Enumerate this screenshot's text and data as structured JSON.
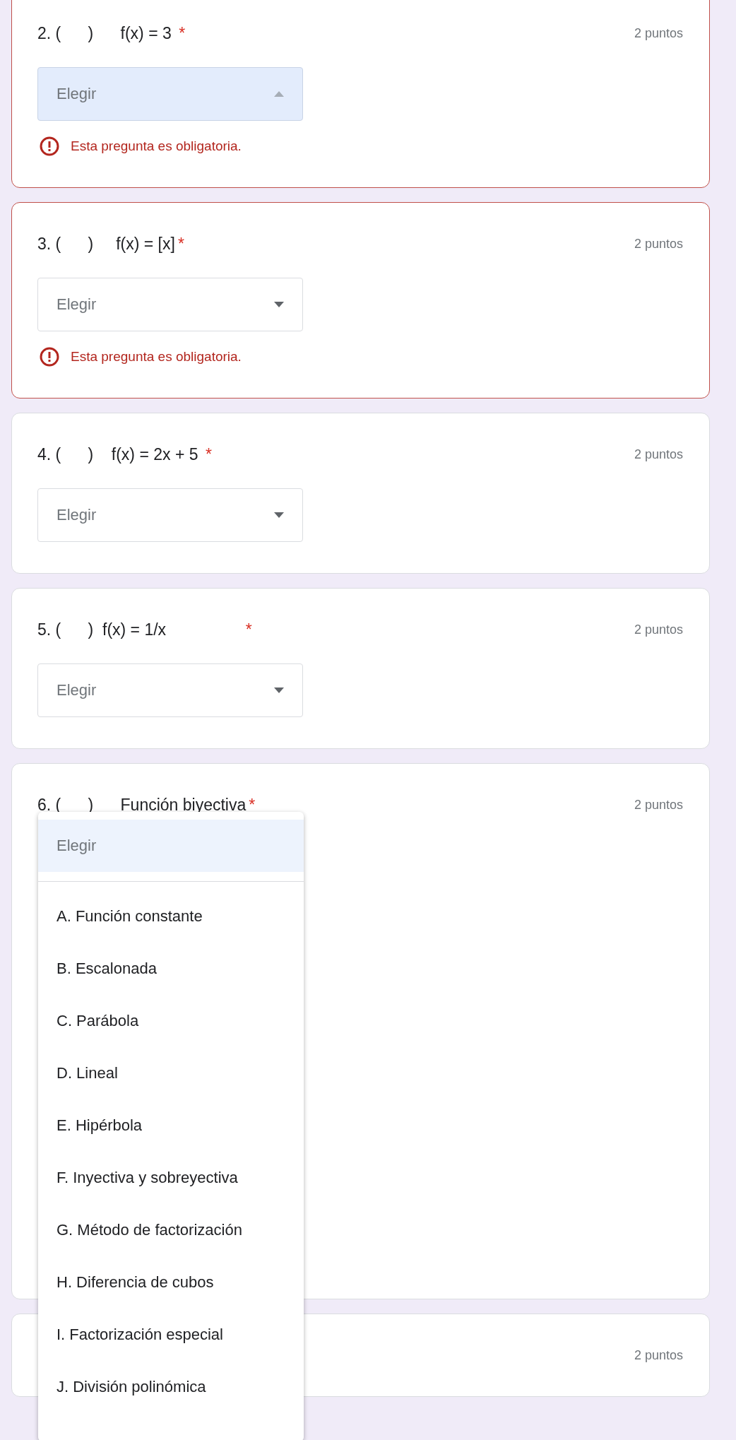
{
  "questions": [
    {
      "title": "2. (      )      f(x) = 3 ",
      "required": true,
      "required_mark": "*",
      "points": "2 puntos",
      "dropdown": {
        "placeholder": "Elegir",
        "focused": true
      },
      "error": "Esta pregunta es obligatoria."
    },
    {
      "title": "3. (      )     f(x) = [x]",
      "required": true,
      "required_mark": "*",
      "points": "2 puntos",
      "dropdown": {
        "placeholder": "Elegir",
        "focused": false
      },
      "error": "Esta pregunta es obligatoria."
    },
    {
      "title": "4. (      )    f(x) = 2x + 5 ",
      "required": true,
      "required_mark": "*",
      "points": "2 puntos",
      "dropdown": {
        "placeholder": "Elegir",
        "focused": false
      }
    },
    {
      "title": "5. (      )  f(x) = 1/x                 ",
      "required": true,
      "required_mark": "*",
      "points": "2 puntos",
      "dropdown": {
        "placeholder": "Elegir",
        "focused": false
      }
    },
    {
      "title": "6. (      )      Función biyectiva",
      "required": true,
      "required_mark": "*",
      "points": "2 puntos",
      "menu": {
        "expanded": true,
        "options": [
          {
            "label": "Elegir",
            "selected": true
          },
          {
            "label": "A. Función constante",
            "selected": false
          },
          {
            "label": "B. Escalonada",
            "selected": false
          },
          {
            "label": "C. Parábola",
            "selected": false
          },
          {
            "label": "D. Lineal",
            "selected": false
          },
          {
            "label": "E. Hipérbola",
            "selected": false
          },
          {
            "label": "F. Inyectiva y sobreyectiva",
            "selected": false
          },
          {
            "label": "G. Método de factorización",
            "selected": false
          },
          {
            "label": "H. Diferencia de cubos",
            "selected": false
          },
          {
            "label": "I. Factorización especial",
            "selected": false
          },
          {
            "label": "J. División polinómica",
            "selected": false
          }
        ]
      }
    },
    {
      "points": "2 puntos"
    }
  ]
}
